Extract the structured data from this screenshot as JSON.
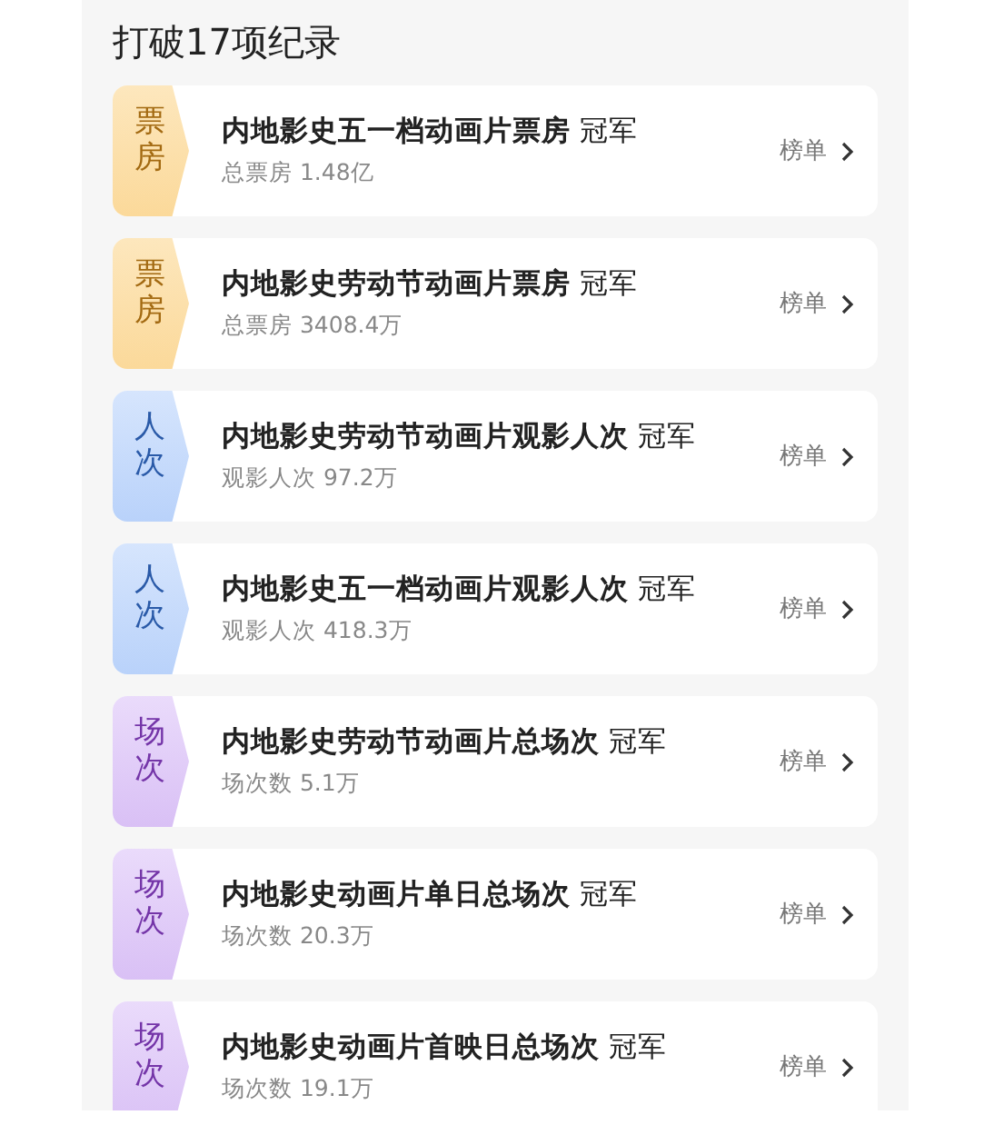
{
  "section_title": "打破17项纪录",
  "records": [
    {
      "kind": "box_office",
      "tag": "票房",
      "title": "内地影史五一档动画片票房",
      "award": "冠军",
      "stat": "总票房 1.48亿",
      "link": "榜单"
    },
    {
      "kind": "box_office",
      "tag": "票房",
      "title": "内地影史劳动节动画片票房",
      "award": "冠军",
      "stat": "总票房 3408.4万",
      "link": "榜单"
    },
    {
      "kind": "admissions",
      "tag": "人次",
      "title": "内地影史劳动节动画片观影人次",
      "award": "冠军",
      "stat": "观影人次 97.2万",
      "link": "榜单"
    },
    {
      "kind": "admissions",
      "tag": "人次",
      "title": "内地影史五一档动画片观影人次",
      "award": "冠军",
      "stat": "观影人次 418.3万",
      "link": "榜单"
    },
    {
      "kind": "screenings",
      "tag": "场次",
      "title": "内地影史劳动节动画片总场次",
      "award": "冠军",
      "stat": "场次数 5.1万",
      "link": "榜单"
    },
    {
      "kind": "screenings",
      "tag": "场次",
      "title": "内地影史动画片单日总场次",
      "award": "冠军",
      "stat": "场次数 20.3万",
      "link": "榜单"
    },
    {
      "kind": "screenings",
      "tag": "场次",
      "title": "内地影史动画片首映日总场次",
      "award": "冠军",
      "stat": "场次数 19.1万",
      "link": "榜单"
    }
  ]
}
